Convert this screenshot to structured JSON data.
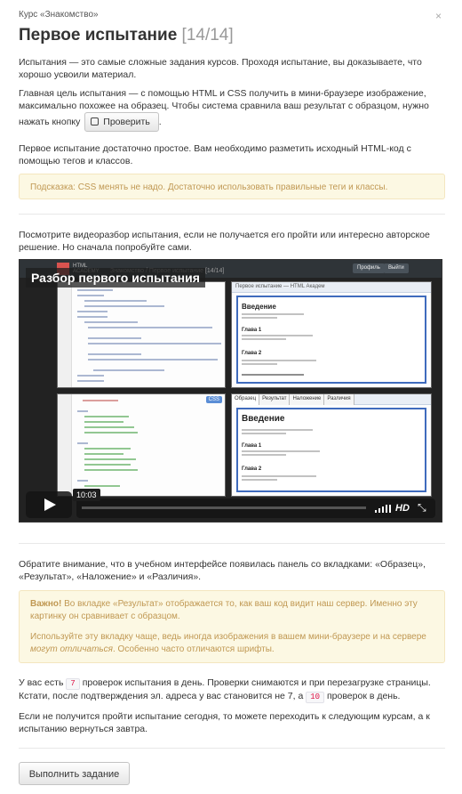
{
  "header": {
    "course": "Курс «Знакомство»",
    "title": "Первое испытание",
    "counter": "[14/14]",
    "close": "×"
  },
  "intro": {
    "p1": "Испытания — это самые сложные задания курсов. Проходя испытание, вы доказываете, что хорошо усвоили материал.",
    "p2_before": "Главная цель испытания — с помощью HTML и CSS получить в мини-браузере изображение, максимально похожее на образец. Чтобы система сравнила ваш результат с образцом, нужно нажать кнопку",
    "check_button": "Проверить",
    "p2_after": ".",
    "p3": "Первое испытание достаточно простое. Вам необходимо разметить исходный HTML-код с помощью тегов и классов."
  },
  "hint": "Подсказка: CSS менять не надо. Достаточно использовать правильные теги и классы.",
  "video": {
    "intro": "Посмотрите видеоразбор испытания, если не получается его пройти или интересно авторское решение. Но сначала попробуйте сами.",
    "title": "Разбор первого испытания",
    "time": "10:03",
    "hd": "HD",
    "app_logo": "HTML ACADEMY",
    "app_crumb": "Знакомство / Первое испытание [14/14]",
    "app_btn_profile": "Профиль",
    "app_btn_exit": "Выйти",
    "css_tag": "CSS",
    "browser_top": "Первое испытание — HTML Академ",
    "tabs": [
      "Образец",
      "Результат",
      "Наложение",
      "Различия"
    ],
    "preview_heading": "Введение",
    "preview_h2a": "Глава 1",
    "preview_h2b": "Глава 2"
  },
  "notice": "Обратите внимание, что в учебном интерфейсе появилась панель со вкладками: «Образец», «Результат», «Наложение» и «Различия».",
  "warning": {
    "strong": "Важно!",
    "line1": " Во вкладке «Результат» отображается то, как ваш код видит наш сервер. Именно эту картинку он сравнивает с образцом.",
    "line2_before": "Используйте эту вкладку чаще, ведь иногда изображения в вашем мини-браузере и на сервере ",
    "line2_em": "могут отличаться",
    "line2_after": ". Особенно часто отличаются шрифты."
  },
  "checks": {
    "before": "У вас есть",
    "per_day": "7",
    "middle": "проверок испытания в день. Проверки снимаются и при перезагрузке страницы. Кстати, после подтверждения эл. адреса у вас становится не 7, а",
    "confirmed": "10",
    "after": "проверок в день."
  },
  "final": "Если не получится пройти испытание сегодня, то можете переходить к следующим курсам, а к испытанию вернуться завтра.",
  "submit": "Выполнить задание"
}
